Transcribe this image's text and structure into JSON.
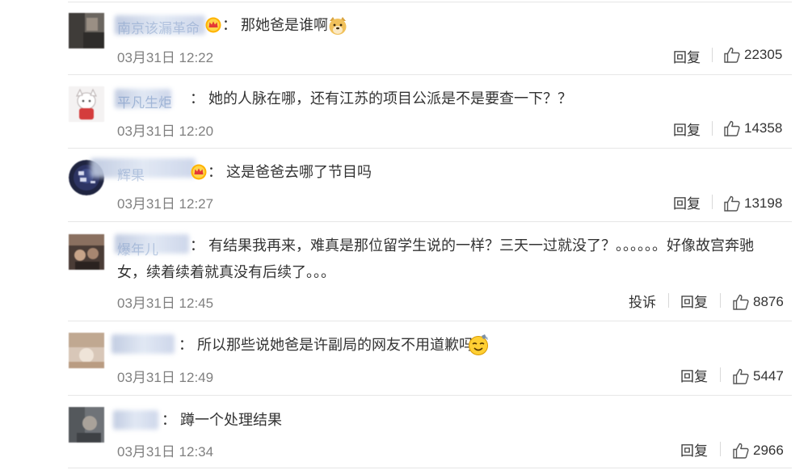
{
  "comments": [
    {
      "name": "南京该漏革命",
      "text": "那她爸是谁啊",
      "time": "03月31日 12:22",
      "reply": "回复",
      "likes": "22305"
    },
    {
      "name": "平凡生炬",
      "text": "她的人脉在哪，还有江苏的项目公派是不是要查一下？？",
      "time": "03月31日 12:20",
      "reply": "回复",
      "likes": "14358"
    },
    {
      "name": "辉果",
      "text": "这是爸爸去哪了节目吗",
      "time": "03月31日 12:27",
      "reply": "回复",
      "likes": "13198"
    },
    {
      "name": "爆年儿",
      "text_line1": "有结果我再来，难真是那位留学生说的一样？三天一过就没了？。。。。。。好像故宫奔驰",
      "text_line2": "女，续着续着就真没有后续了。。。",
      "time": "03月31日 12:45",
      "report": "投诉",
      "reply": "回复",
      "likes": "8876"
    },
    {
      "name": "",
      "text": "所以那些说她爸是许副局的网友不用道歉吗",
      "time": "03月31日 12:49",
      "reply": "回复",
      "likes": "5447"
    },
    {
      "name": "",
      "text": "蹲一个处理结果",
      "time": "03月31日 12:34",
      "reply": "回复",
      "likes": "2966"
    }
  ],
  "colors": {
    "name": "#5b80b8",
    "text": "#333333",
    "meta": "#808080",
    "divider": "#e6e6e6"
  },
  "icons": {
    "like": "thumbs-up-icon",
    "vip": "crown-vip-icon",
    "doge": "doge-emoji",
    "sweat": "sweat-smile-emoji"
  }
}
